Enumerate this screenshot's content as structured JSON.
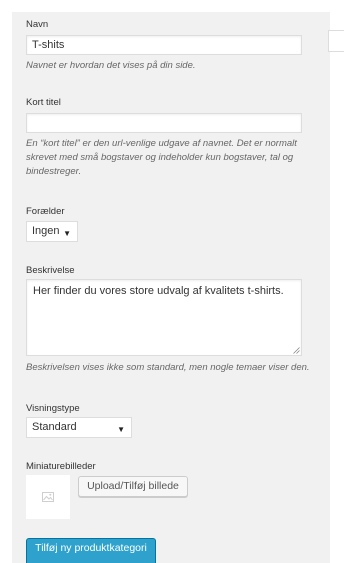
{
  "name": {
    "label": "Navn",
    "value": "T-shits",
    "hint": "Navnet er hvordan det vises på din side."
  },
  "slug": {
    "label": "Kort titel",
    "value": "",
    "hint_line1": "En “kort titel” er den url-venlige udgave af navnet. Det er normalt",
    "hint_line2": "skrevet med små bogstaver og indeholder kun bogstaver, tal og",
    "hint_line3": "bindestreger."
  },
  "parent": {
    "label": "Forælder",
    "selected": "Ingen"
  },
  "description": {
    "label": "Beskrivelse",
    "value": "Her finder du vores store udvalg af kvalitets t-shirts.",
    "hint": "Beskrivelsen vises ikke som standard, men nogle temaer viser den."
  },
  "display_type": {
    "label": "Visningstype",
    "selected": "Standard"
  },
  "thumbnail": {
    "label": "Miniaturebilleder",
    "upload_label": "Upload/Tilføj billede",
    "placeholder_icon": "image-placeholder-icon"
  },
  "submit": {
    "label": "Tilføj ny produktkategori"
  },
  "colors": {
    "panel": "#f1f1f1",
    "primary": "#2ea2cc"
  }
}
